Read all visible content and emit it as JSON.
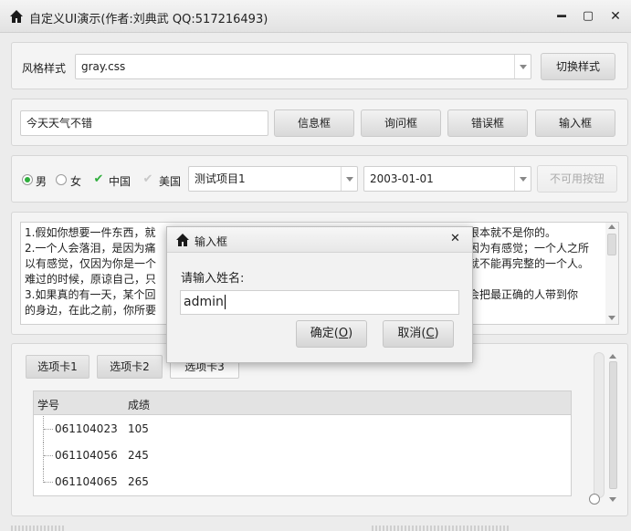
{
  "window": {
    "title": "自定义UI演示(作者:刘典武 QQ:517216493)",
    "min_glyph": "━",
    "max_glyph": "▢",
    "close_glyph": "✕"
  },
  "style_row": {
    "label": "风格样式",
    "value": "gray.css",
    "button": "切换样式"
  },
  "msg_row": {
    "input_value": "今天天气不错",
    "btn_info": "信息框",
    "btn_question": "询问框",
    "btn_error": "错误框",
    "btn_input": "输入框"
  },
  "options_row": {
    "radio_male": "男",
    "radio_female": "女",
    "check_china": "中国",
    "check_usa": "美国",
    "combo_project": "测试项目1",
    "date_value": "2003-01-01",
    "disabled_button": "不可用按钮"
  },
  "text_area": {
    "lines": [
      "1.假如你想要一件东西，就",
      "2.一个人会落泪，是因为痛",
      "以有感觉，仅因为你是一个",
      "难过的时候，原谅自己，只",
      "3.如果真的有一天，某个回",
      "的身边，在此之前，你所要"
    ],
    "right_lines": [
      "根本就不是你的。",
      "因为有感觉；一个人之所",
      "就不能再完整的一个人。",
      "",
      "会把最正确的人带到你",
      ""
    ]
  },
  "tabs": [
    "选项卡1",
    "选项卡2",
    "选项卡3"
  ],
  "tree": {
    "headers": [
      "学号",
      "成绩"
    ],
    "rows": [
      {
        "id": "061104023",
        "score": "105"
      },
      {
        "id": "061104056",
        "score": "245"
      },
      {
        "id": "061104065",
        "score": "265"
      }
    ]
  },
  "dialog": {
    "title": "输入框",
    "close_glyph": "✕",
    "prompt": "请输入姓名:",
    "input_value": "admin",
    "ok_label": "确定(",
    "ok_key": "O",
    "cancel_label": "取消(",
    "cancel_key": "C",
    "paren_close": ")"
  },
  "colors": {
    "accent_green": "#2fae3d"
  },
  "icons": {
    "window": "home-icon",
    "dialog": "home-icon"
  }
}
